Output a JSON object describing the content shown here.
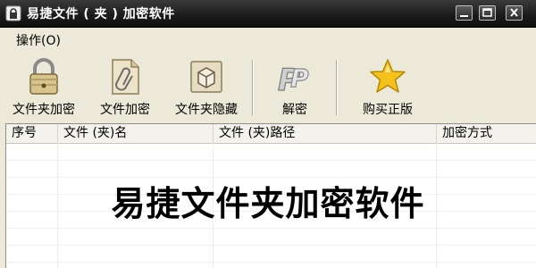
{
  "window": {
    "title": "易捷文件 ( 夹 ) 加密软件",
    "controls": {
      "minimize": "minimize",
      "maximize": "maximize",
      "close": "close"
    }
  },
  "menu": {
    "items": [
      {
        "label": "操作(O)"
      }
    ]
  },
  "toolbar": {
    "items": [
      {
        "label": "文件夹加密",
        "icon": "padlock-icon"
      },
      {
        "label": "文件加密",
        "icon": "paper-clip-document-icon"
      },
      {
        "label": "文件夹隐藏",
        "icon": "box-icon"
      },
      {
        "label": "解密",
        "icon": "p-logo-icon"
      },
      {
        "label": "购买正版",
        "icon": "star-icon"
      }
    ]
  },
  "table": {
    "columns": [
      "序号",
      "文件 (夹)名",
      "文件 (夹)路径",
      "加密方式"
    ],
    "rows": []
  },
  "overlay_title": "易捷文件夹加密软件",
  "colors": {
    "titlebar": "#1c1c1c",
    "chrome": "#ece9d8",
    "star": "#f4c21a"
  }
}
